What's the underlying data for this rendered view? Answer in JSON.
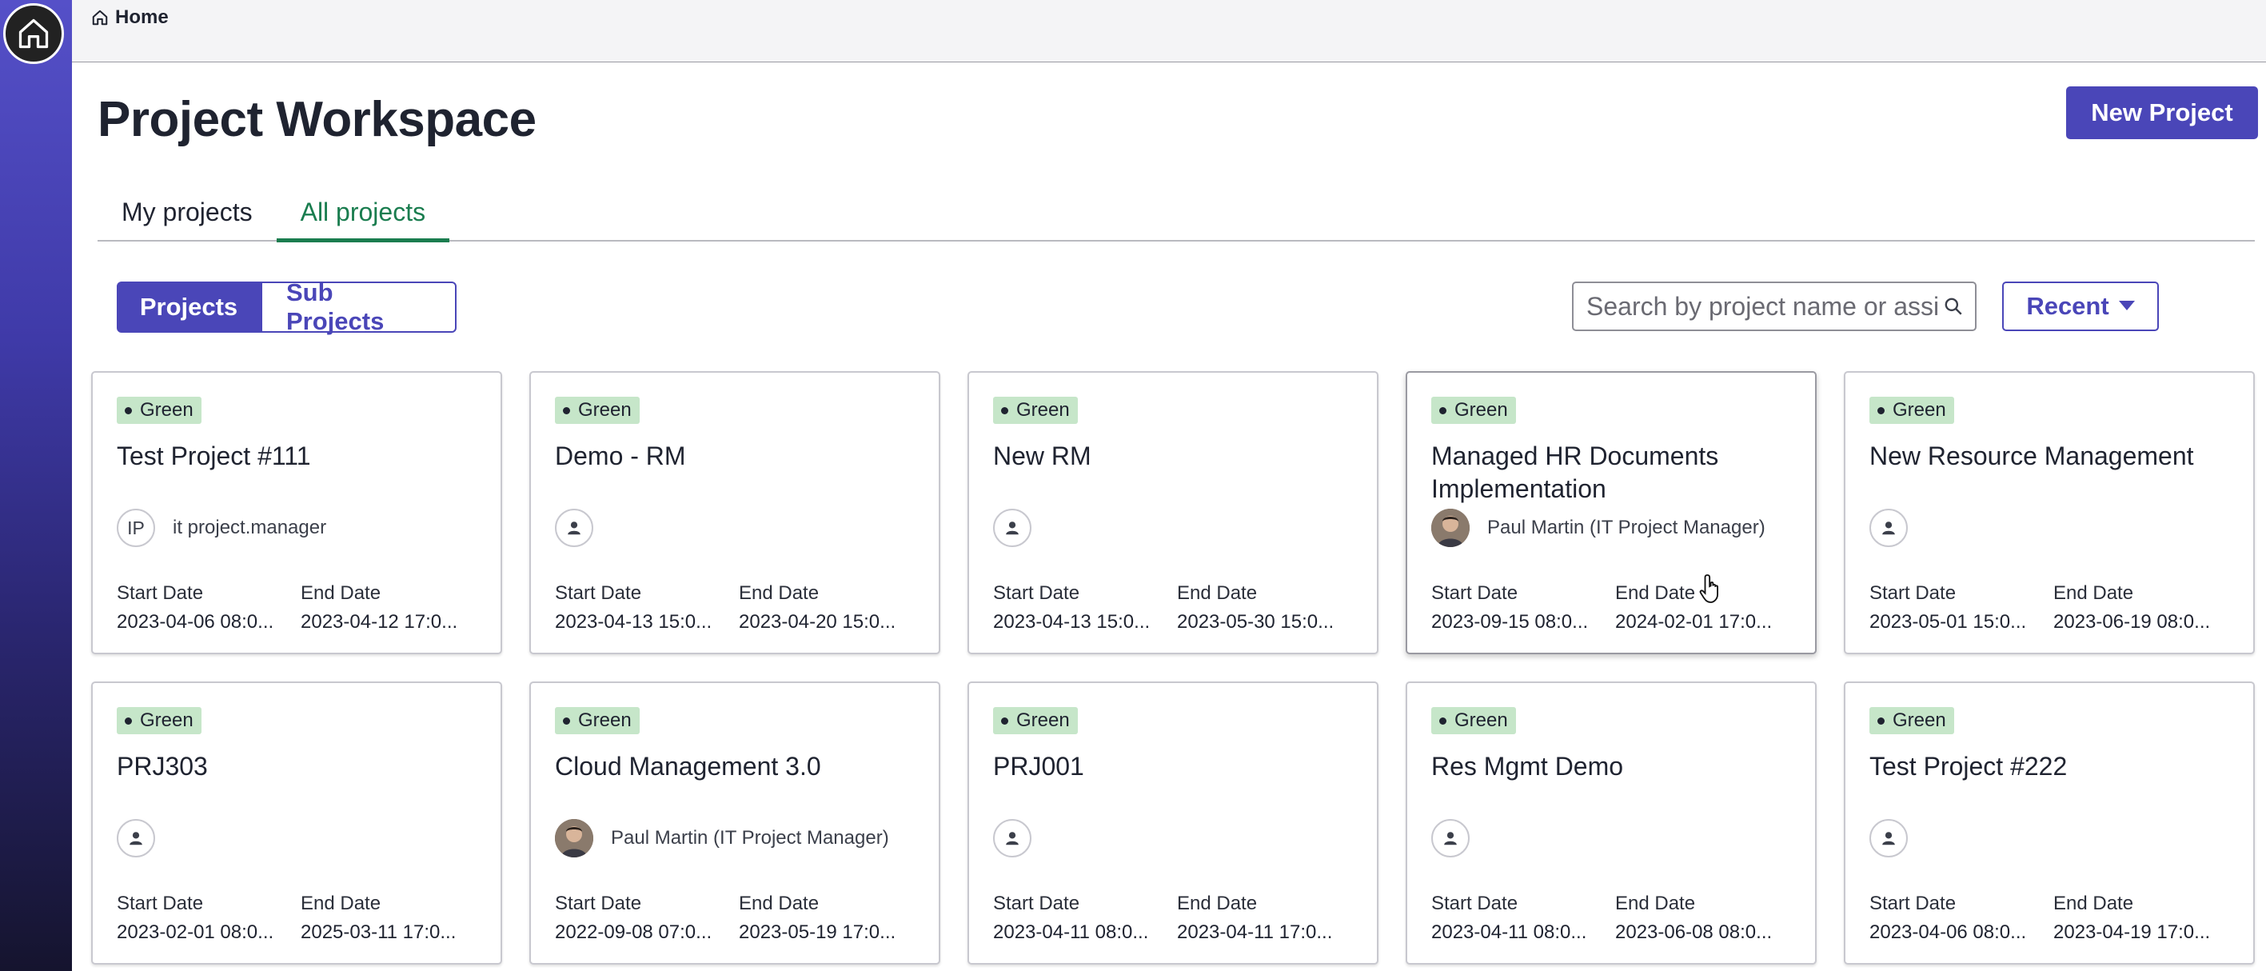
{
  "breadcrumb": {
    "label": "Home"
  },
  "page": {
    "title": "Project Workspace",
    "new_project_label": "New Project"
  },
  "tabs": [
    {
      "label": "My projects",
      "active": false
    },
    {
      "label": "All projects",
      "active": true
    }
  ],
  "toggle": {
    "projects_label": "Projects",
    "sub_projects_label": "Sub Projects",
    "selected": "Projects"
  },
  "search": {
    "placeholder": "Search by project name or assi"
  },
  "sort": {
    "label": "Recent"
  },
  "colors": {
    "accent": "#4a46b8",
    "tab_active": "#1a7d4f",
    "status_green_bg": "#c6e6c9"
  },
  "cards": [
    {
      "status": "Green",
      "title": "Test Project #111",
      "manager": {
        "type": "initials",
        "initials": "IP",
        "name": "it project.manager"
      },
      "start_label": "Start Date",
      "start": "2023-04-06 08:0...",
      "end_label": "End Date",
      "end": "2023-04-12 17:0..."
    },
    {
      "status": "Green",
      "title": "Demo - RM",
      "manager": {
        "type": "empty",
        "name": ""
      },
      "start_label": "Start Date",
      "start": "2023-04-13 15:0...",
      "end_label": "End Date",
      "end": "2023-04-20 15:0..."
    },
    {
      "status": "Green",
      "title": "New RM",
      "manager": {
        "type": "empty",
        "name": ""
      },
      "start_label": "Start Date",
      "start": "2023-04-13 15:0...",
      "end_label": "End Date",
      "end": "2023-05-30 15:0..."
    },
    {
      "status": "Green",
      "title": "Managed HR Documents Implementation",
      "manager": {
        "type": "photo",
        "name": "Paul Martin (IT Project Manager)"
      },
      "start_label": "Start Date",
      "start": "2023-09-15 08:0...",
      "end_label": "End Date",
      "end": "2024-02-01 17:0..."
    },
    {
      "status": "Green",
      "title": "New Resource Management",
      "manager": {
        "type": "empty",
        "name": ""
      },
      "start_label": "Start Date",
      "start": "2023-05-01 15:0...",
      "end_label": "End Date",
      "end": "2023-06-19 08:0..."
    },
    {
      "status": "Green",
      "title": "PRJ303",
      "manager": {
        "type": "empty",
        "name": ""
      },
      "start_label": "Start Date",
      "start": "2023-02-01 08:0...",
      "end_label": "End Date",
      "end": "2025-03-11 17:0..."
    },
    {
      "status": "Green",
      "title": "Cloud Management 3.0",
      "manager": {
        "type": "photo",
        "name": "Paul Martin (IT Project Manager)"
      },
      "start_label": "Start Date",
      "start": "2022-09-08 07:0...",
      "end_label": "End Date",
      "end": "2023-05-19 17:0..."
    },
    {
      "status": "Green",
      "title": "PRJ001",
      "manager": {
        "type": "empty",
        "name": ""
      },
      "start_label": "Start Date",
      "start": "2023-04-11 08:0...",
      "end_label": "End Date",
      "end": "2023-04-11 17:0..."
    },
    {
      "status": "Green",
      "title": "Res Mgmt Demo",
      "manager": {
        "type": "empty",
        "name": ""
      },
      "start_label": "Start Date",
      "start": "2023-04-11 08:0...",
      "end_label": "End Date",
      "end": "2023-06-08 08:0..."
    },
    {
      "status": "Green",
      "title": "Test Project #222",
      "manager": {
        "type": "empty",
        "name": ""
      },
      "start_label": "Start Date",
      "start": "2023-04-06 08:0...",
      "end_label": "End Date",
      "end": "2023-04-19 17:0..."
    }
  ]
}
